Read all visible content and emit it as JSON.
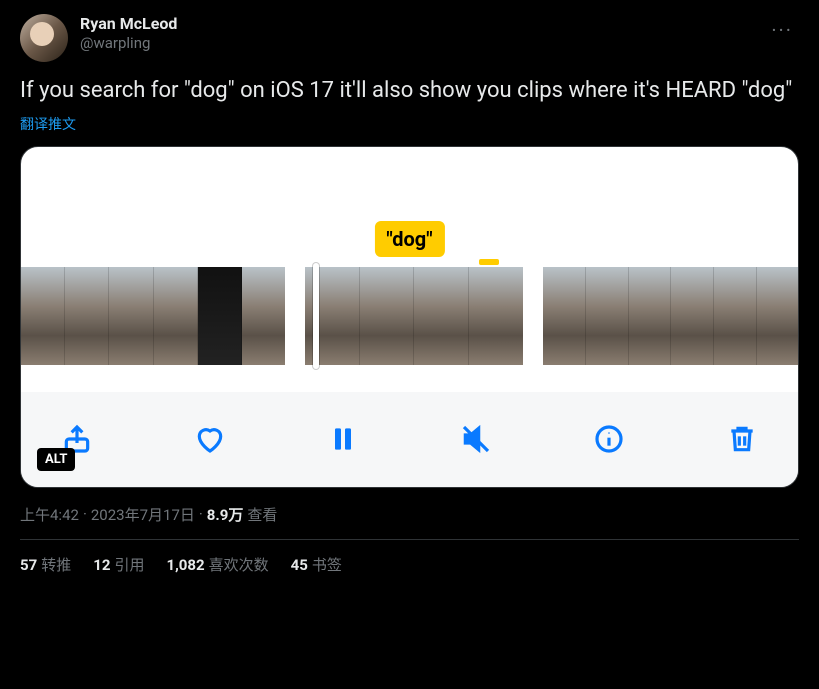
{
  "user": {
    "display_name": "Ryan McLeod",
    "handle": "@warpling"
  },
  "more_label": "···",
  "tweet_text": "If you search for \"dog\" on iOS 17 it'll also show you clips where it's HEARD \"dog\"",
  "translate_label": "翻译推文",
  "media": {
    "badge_text": "\"dog\"",
    "alt_badge": "ALT",
    "controls": {
      "share": "share-icon",
      "like": "heart-icon",
      "pause": "pause-icon",
      "mute": "mute-icon",
      "info": "info-icon",
      "trash": "trash-icon"
    }
  },
  "meta": {
    "time": "上午4:42",
    "dot1": "·",
    "date": "2023年7月17日",
    "dot2": "·",
    "views_count": "8.9万",
    "views_label": "查看"
  },
  "stats": {
    "retweets_count": "57",
    "retweets_label": "转推",
    "quotes_count": "12",
    "quotes_label": "引用",
    "likes_count": "1,082",
    "likes_label": "喜欢次数",
    "bookmarks_count": "45",
    "bookmarks_label": "书签"
  }
}
